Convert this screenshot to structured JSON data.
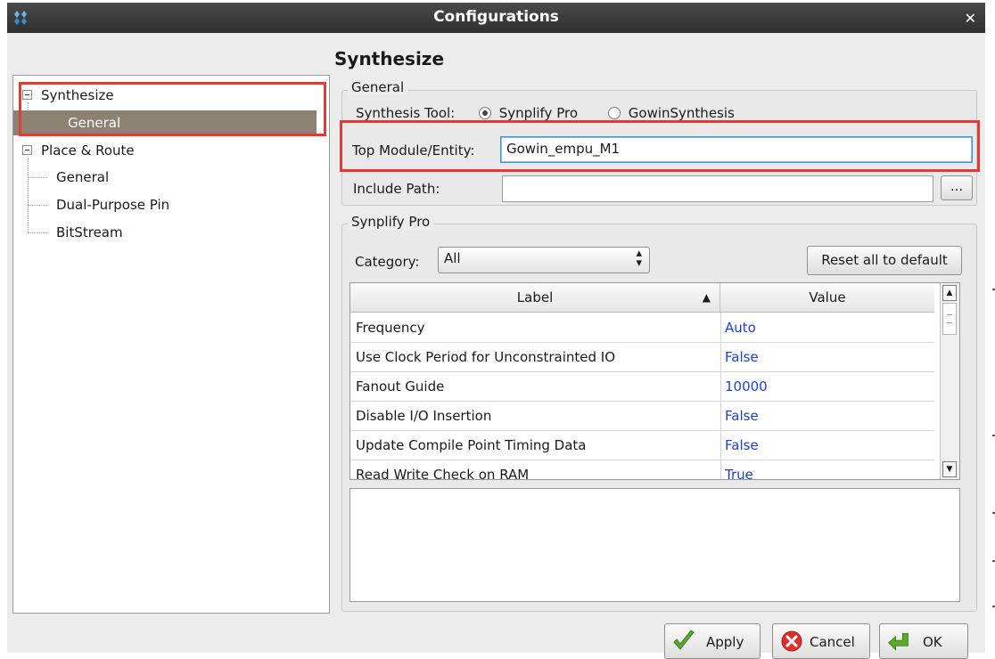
{
  "window": {
    "title": "Configurations"
  },
  "tree": {
    "items": [
      {
        "label": "Synthesize"
      },
      {
        "label": "General"
      },
      {
        "label": "Place & Route"
      },
      {
        "label": "General"
      },
      {
        "label": "Dual-Purpose Pin"
      },
      {
        "label": "BitStream"
      }
    ]
  },
  "page": {
    "heading": "Synthesize"
  },
  "general": {
    "group_title": "General",
    "synthesis_tool_label": "Synthesis Tool:",
    "options": [
      "Synplify Pro",
      "GowinSynthesis"
    ],
    "selected": "Synplify Pro",
    "top_module_label": "Top Module/Entity:",
    "top_module_value": "Gowin_empu_M1",
    "include_path_label": "Include Path:",
    "include_path_value": "",
    "browse_label": "..."
  },
  "synplify": {
    "group_title": "Synplify Pro",
    "category_label": "Category:",
    "category_value": "All",
    "reset_label": "Reset all to default",
    "table": {
      "headers": [
        "Label",
        "Value"
      ],
      "rows": [
        {
          "label": "Frequency",
          "value": "Auto"
        },
        {
          "label": "Use Clock Period for Unconstrainted IO",
          "value": "False"
        },
        {
          "label": "Fanout Guide",
          "value": "10000"
        },
        {
          "label": "Disable I/O Insertion",
          "value": "False"
        },
        {
          "label": "Update Compile Point Timing Data",
          "value": "False"
        },
        {
          "label": "Read Write Check on RAM",
          "value": "True"
        }
      ]
    }
  },
  "buttons": {
    "apply": "Apply",
    "cancel": "Cancel",
    "ok": "OK"
  },
  "colors": {
    "selection": "#8c8271",
    "highlight_box": "#e53935",
    "value_text": "#1f3fd6"
  }
}
